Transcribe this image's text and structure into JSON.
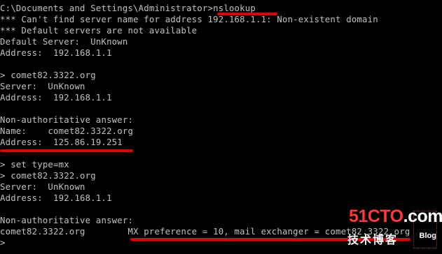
{
  "console": {
    "lines": [
      "C:\\Documents and Settings\\Administrator>nslookup",
      "*** Can't find server name for address 192.168.1.1: Non-existent domain",
      "*** Default servers are not available",
      "Default Server:  UnKnown",
      "Address:  192.168.1.1",
      "",
      "> comet82.3322.org",
      "Server:  UnKnown",
      "Address:  192.168.1.1",
      "",
      "Non-authoritative answer:",
      "Name:    comet82.3322.org",
      "Address:  125.86.19.251",
      "",
      "> set type=mx",
      "> comet82.3322.org",
      "Server:  UnKnown",
      "Address:  192.168.1.1",
      "",
      "Non-authoritative answer:",
      "comet82.3322.org        MX preference = 10, mail exchanger = comet82.3322.org",
      ">"
    ]
  },
  "watermark": {
    "logo_part1": "51CTO",
    "logo_part2": ".com",
    "subtitle": "技术博客",
    "blog": "Blog"
  },
  "colors": {
    "background": "#000000",
    "text": "#c0c0c0",
    "annotation": "#e00000"
  }
}
